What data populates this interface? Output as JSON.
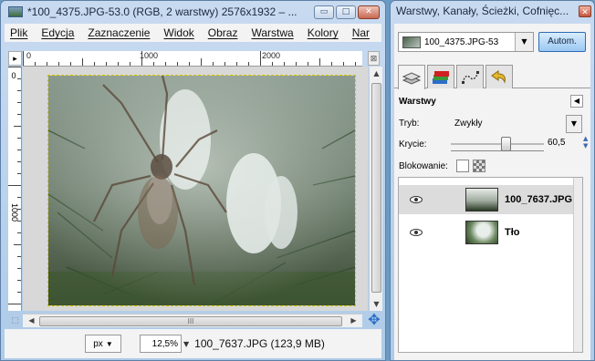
{
  "image_window": {
    "title": "*100_4375.JPG-53.0 (RGB, 2 warstwy) 2576x1932 – ...",
    "menu": [
      "Plik",
      "Edycja",
      "Zaznaczenie",
      "Widok",
      "Obraz",
      "Warstwa",
      "Kolory",
      "Nar"
    ],
    "ruler_labels": [
      "0",
      "1000",
      "2000"
    ],
    "ruler_left_labels": [
      "0",
      "1000"
    ],
    "status": {
      "unit": "px",
      "zoom": "12,5%",
      "layer_info": "100_7637.JPG (123,9 MB)"
    },
    "scroll_grip": "III"
  },
  "dock": {
    "title": "Warstwy, Kanały, Ścieżki, Cofnięc...",
    "image_selector": "100_4375.JPG-53",
    "auto_button": "Autom.",
    "panel_title": "Warstwy",
    "mode_label": "Tryb:",
    "mode_value": "Zwykły",
    "opacity_label": "Krycie:",
    "opacity_value": "60,5",
    "opacity_fraction": 0.605,
    "lock_label": "Blokowanie:",
    "layers": [
      {
        "name": "100_7637.JPG",
        "visible": true,
        "selected": true
      },
      {
        "name": "Tło",
        "visible": true,
        "selected": false
      }
    ]
  },
  "colors": {
    "accent_blue": "#2a6cc8",
    "titlebar": "#c8daf0",
    "close_red": "#c76a52",
    "selection_dash": "#d4c400"
  }
}
